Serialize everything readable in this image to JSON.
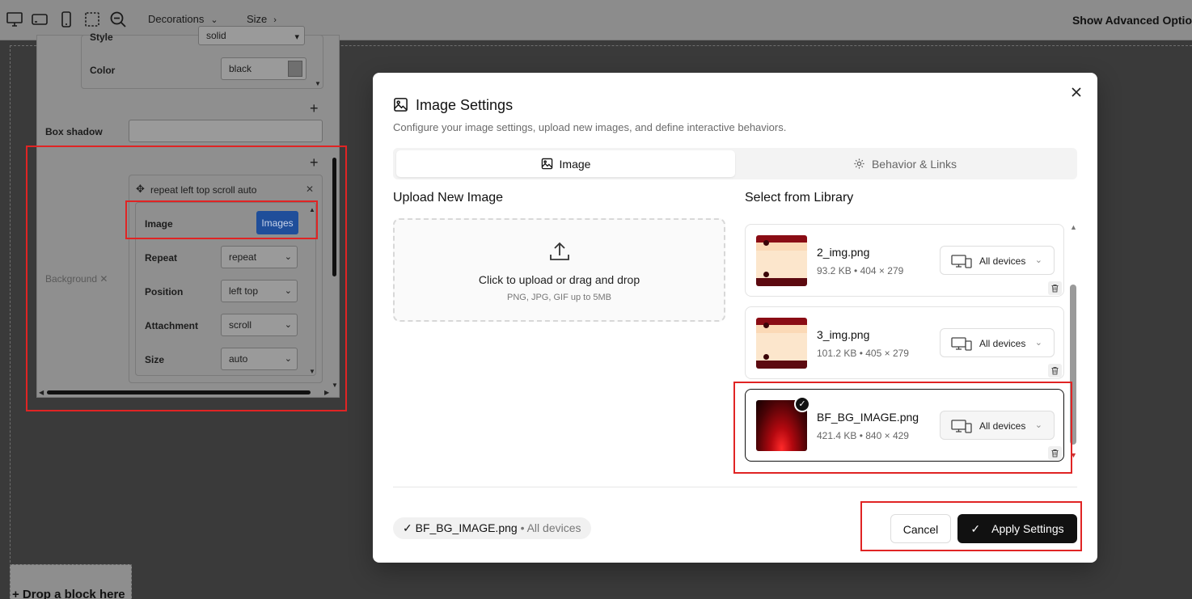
{
  "toolbar": {
    "decorations_label": "Decorations",
    "size_label": "Size",
    "advanced_label": "Show Advanced Optio"
  },
  "canvas": {
    "drop_block_label": "+ Drop a block here"
  },
  "style_panel": {
    "style_label": "Style",
    "style_value": "solid",
    "color_label": "Color",
    "color_value": "black",
    "box_shadow_label": "Box shadow",
    "background_label": "Background",
    "layer_title": "repeat left top scroll auto",
    "image_label": "Image",
    "images_button": "Images",
    "repeat_label": "Repeat",
    "repeat_value": "repeat",
    "position_label": "Position",
    "position_value": "left top",
    "attachment_label": "Attachment",
    "attachment_value": "scroll",
    "size_label": "Size",
    "size_value": "auto"
  },
  "modal": {
    "title": "Image Settings",
    "description": "Configure your image settings, upload new images, and define interactive behaviors.",
    "tabs": [
      {
        "label": "Image",
        "active": true,
        "icon": "image-icon"
      },
      {
        "label": "Behavior & Links",
        "active": false,
        "icon": "gear-icon"
      }
    ],
    "upload": {
      "heading": "Upload New Image",
      "main_text": "Click to upload or drag and drop",
      "sub_text": "PNG, JPG, GIF up to 5MB"
    },
    "library": {
      "heading": "Select from Library",
      "items": [
        {
          "name": "2_img.png",
          "meta": "93.2 KB • 404 × 279",
          "devices": "All devices",
          "selected": false
        },
        {
          "name": "3_img.png",
          "meta": "101.2 KB • 405 × 279",
          "devices": "All devices",
          "selected": false
        },
        {
          "name": "BF_BG_IMAGE.png",
          "meta": "421.4 KB • 840 × 429",
          "devices": "All devices",
          "selected": true
        }
      ]
    },
    "selection": {
      "name": "BF_BG_IMAGE.png",
      "devices": "• All devices"
    },
    "cancel_label": "Cancel",
    "apply_label": "Apply Settings"
  },
  "colors": {
    "accent_dark": "#111111",
    "highlight_red": "#e02424",
    "images_button_blue": "#1f4e9a"
  }
}
